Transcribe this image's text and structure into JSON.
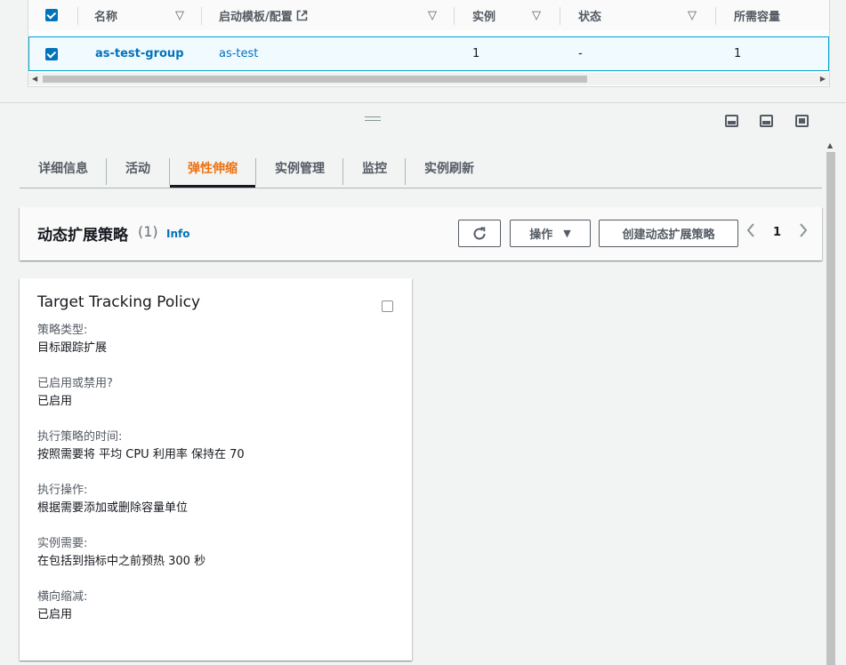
{
  "table": {
    "headers": [
      "名称",
      "启动模板/配置",
      "实例",
      "状态",
      "所需容量"
    ],
    "row": {
      "name": "as-test-group",
      "template": "as-test",
      "instances": "1",
      "status": "-",
      "desired": "1"
    }
  },
  "tabs": [
    "详细信息",
    "活动",
    "弹性伸缩",
    "实例管理",
    "监控",
    "实例刷新"
  ],
  "active_tab": "弹性伸缩",
  "policies": {
    "title": "动态扩展策略",
    "count": "(1)",
    "info": "Info",
    "actions_label": "操作",
    "create_label": "创建动态扩展策略",
    "page": "1"
  },
  "card": {
    "title": "Target Tracking Policy",
    "fields": [
      {
        "label": "策略类型:",
        "value": "目标跟踪扩展"
      },
      {
        "label": "已启用或禁用?",
        "value": "已启用"
      },
      {
        "label": "执行策略的时间:",
        "value": "按照需要将 平均 CPU 利用率 保持在 70"
      },
      {
        "label": "执行操作:",
        "value": "根据需要添加或删除容量单位"
      },
      {
        "label": "实例需要:",
        "value": "在包括到指标中之前预热 300 秒"
      },
      {
        "label": "横向缩减:",
        "value": "已启用"
      }
    ]
  },
  "colors": {
    "accent": "#ec7211",
    "link": "#0073bb",
    "selected_row": "#f1faff"
  }
}
